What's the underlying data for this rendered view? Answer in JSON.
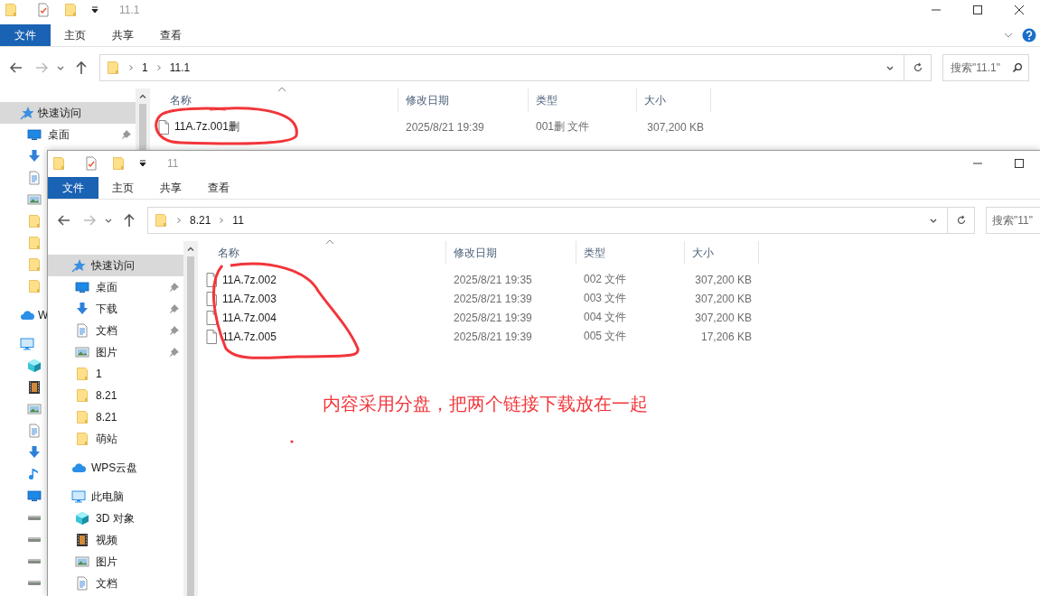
{
  "windows": [
    {
      "title": "11.1",
      "closable": true,
      "help": true,
      "ribbon_tabs": [
        {
          "label": "文件",
          "selected": true
        },
        {
          "label": "主页",
          "selected": false
        },
        {
          "label": "共享",
          "selected": false
        },
        {
          "label": "查看",
          "selected": false
        }
      ],
      "breadcrumb": [
        "1",
        "11.1"
      ],
      "search": {
        "placeholder": "搜索\"11.1\"",
        "icon": true
      },
      "nav": [
        {
          "kind": "star",
          "label": "快速访问",
          "selected": true,
          "children": [
            {
              "kind": "desktop",
              "label": "桌面",
              "pinned": true
            },
            {
              "kind": "download"
            },
            {
              "kind": "document"
            },
            {
              "kind": "picture"
            },
            {
              "kind": "folder"
            },
            {
              "kind": "folder"
            },
            {
              "kind": "folder"
            },
            {
              "kind": "folder"
            }
          ]
        },
        {
          "kind": "cloud",
          "label": "W",
          "selected": false
        },
        {
          "kind": "pc",
          "selected": false,
          "children": [
            {
              "kind": "cube"
            },
            {
              "kind": "video"
            },
            {
              "kind": "picture"
            },
            {
              "kind": "document"
            },
            {
              "kind": "download"
            },
            {
              "kind": "music"
            },
            {
              "kind": "desktop"
            },
            {
              "kind": "drive"
            },
            {
              "kind": "drive"
            },
            {
              "kind": "drive"
            },
            {
              "kind": "drive"
            }
          ]
        }
      ],
      "columns": [
        "名称",
        "修改日期",
        "类型",
        "大小"
      ],
      "files": [
        {
          "name": "11A.7z.001删",
          "date": "2025/8/21 19:39",
          "type": "001删 文件",
          "size": "307,200 KB"
        }
      ]
    },
    {
      "title": "11",
      "closable": false,
      "help": false,
      "ribbon_tabs": [
        {
          "label": "文件",
          "selected": true
        },
        {
          "label": "主页",
          "selected": false
        },
        {
          "label": "共享",
          "selected": false
        },
        {
          "label": "查看",
          "selected": false
        }
      ],
      "breadcrumb": [
        "8.21",
        "11"
      ],
      "search": {
        "placeholder": "搜索\"11\"",
        "icon": false
      },
      "nav": [
        {
          "kind": "star",
          "label": "快速访问",
          "selected": true,
          "children": [
            {
              "kind": "desktop",
              "label": "桌面",
              "pinned": true
            },
            {
              "kind": "download",
              "label": "下载",
              "pinned": true
            },
            {
              "kind": "document",
              "label": "文档",
              "pinned": true
            },
            {
              "kind": "picture",
              "label": "图片",
              "pinned": true
            },
            {
              "kind": "folder",
              "label": "1",
              "pinned": false
            },
            {
              "kind": "folder",
              "label": "8.21",
              "pinned": false
            },
            {
              "kind": "folder",
              "label": "8.21",
              "pinned": false
            },
            {
              "kind": "folder",
              "label": "萌站",
              "pinned": false
            }
          ]
        },
        {
          "kind": "cloud",
          "label": "WPS云盘",
          "selected": false
        },
        {
          "kind": "pc",
          "label": "此电脑",
          "selected": false,
          "children": [
            {
              "kind": "cube",
              "label": "3D 对象",
              "pinned": false
            },
            {
              "kind": "video",
              "label": "视频",
              "pinned": false
            },
            {
              "kind": "picture",
              "label": "图片",
              "pinned": false
            },
            {
              "kind": "document",
              "label": "文档",
              "pinned": false
            }
          ]
        }
      ],
      "columns": [
        "名称",
        "修改日期",
        "类型",
        "大小"
      ],
      "files": [
        {
          "name": "11A.7z.002",
          "date": "2025/8/21 19:35",
          "type": "002 文件",
          "size": "307,200 KB"
        },
        {
          "name": "11A.7z.003",
          "date": "2025/8/21 19:39",
          "type": "003 文件",
          "size": "307,200 KB"
        },
        {
          "name": "11A.7z.004",
          "date": "2025/8/21 19:39",
          "type": "004 文件",
          "size": "307,200 KB"
        },
        {
          "name": "11A.7z.005",
          "date": "2025/8/21 19:39",
          "type": "005 文件",
          "size": "17,206 KB"
        }
      ]
    }
  ],
  "annotation": "内容采用分盘，把两个链接下载放在一起"
}
